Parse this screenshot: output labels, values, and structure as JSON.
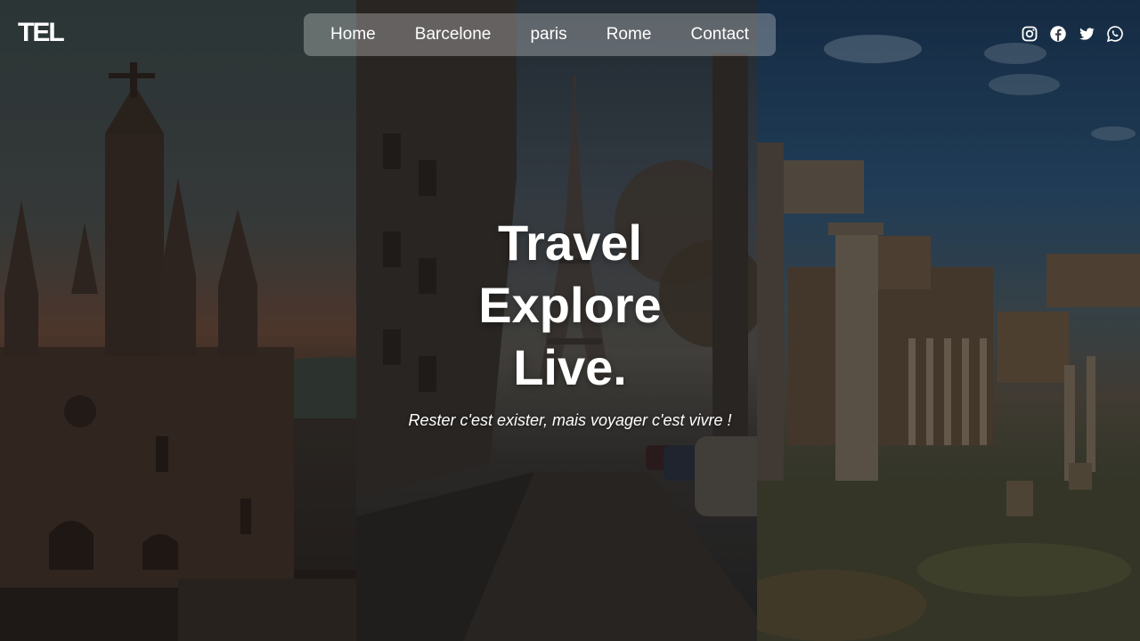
{
  "logo": {
    "text": "TEL"
  },
  "nav": {
    "items": [
      {
        "label": "Home"
      },
      {
        "label": "Barcelone"
      },
      {
        "label": "paris"
      },
      {
        "label": "Rome"
      },
      {
        "label": "Contact"
      }
    ]
  },
  "social": {
    "icons": [
      "instagram-icon",
      "facebook-icon",
      "twitter-icon",
      "whatsapp-icon"
    ]
  },
  "hero": {
    "line1": "Travel",
    "line2": "Explore",
    "line3": "Live.",
    "tagline": "Rester c'est exister, mais voyager c'est vivre !"
  },
  "background": {
    "panels": [
      "Barcelona cathedral",
      "Paris Eiffel Tower street",
      "Rome Forum ruins"
    ]
  },
  "colors": {
    "nav_bg": "rgba(255,255,255,0.28)",
    "text": "#ffffff"
  }
}
